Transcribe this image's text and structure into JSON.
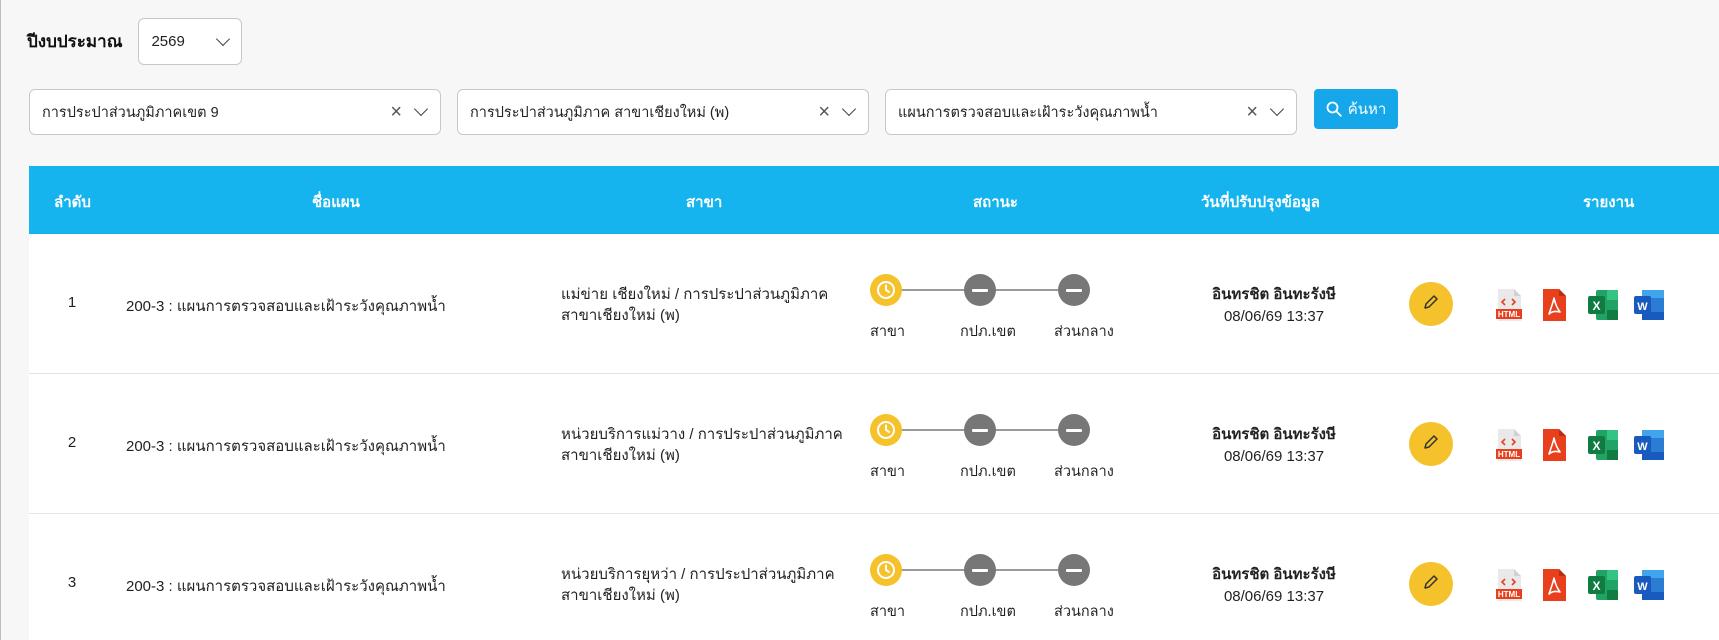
{
  "year": {
    "label": "ปีงบประมาณ",
    "value": "2569"
  },
  "filters": [
    {
      "value": "การประปาส่วนภูมิภาคเขต 9",
      "clear_icon": "×"
    },
    {
      "value": "การประปาส่วนภูมิภาค สาขาเชียงใหม่ (พ)",
      "clear_icon": "×"
    },
    {
      "value": "แผนการตรวจสอบและเฝ้าระวังคุณภาพน้ำ",
      "clear_icon": "×"
    }
  ],
  "search_button": {
    "label": "ค้นหา",
    "icon": "search-icon"
  },
  "table": {
    "headers": {
      "no": "ลำดับ",
      "plan": "ชื่อแผน",
      "branch": "สาขา",
      "status": "สถานะ",
      "updated": "วันที่ปรับปรุงข้อมูล",
      "report": "รายงาน"
    },
    "status_labels": [
      "สาขา",
      "กปภ.เขต",
      "ส่วนกลาง"
    ],
    "rows": [
      {
        "no": "1",
        "plan": "200-3 : แผนการตรวจสอบและเฝ้าระวังคุณภาพน้ำ",
        "branch_line1": "แม่ข่าย เชียงใหม่ / การประปาส่วนภูมิภาค",
        "branch_line2": "สาขาเชียงใหม่ (พ)",
        "updated_by": "อินทรชิต อินทะรังษี",
        "updated_at": "08/06/69 13:37"
      },
      {
        "no": "2",
        "plan": "200-3 : แผนการตรวจสอบและเฝ้าระวังคุณภาพน้ำ",
        "branch_line1": "หน่วยบริการแม่วาง / การประปาส่วนภูมิภาค",
        "branch_line2": "สาขาเชียงใหม่ (พ)",
        "updated_by": "อินทรชิต อินทะรังษี",
        "updated_at": "08/06/69 13:37"
      },
      {
        "no": "3",
        "plan": "200-3 : แผนการตรวจสอบและเฝ้าระวังคุณภาพน้ำ",
        "branch_line1": "หน่วยบริการยุหว่า / การประปาส่วนภูมิภาค",
        "branch_line2": "สาขาเชียงใหม่ (พ)",
        "updated_by": "อินทรชิต อินทะรังษี",
        "updated_at": "08/06/69 13:37"
      }
    ],
    "report_icons": [
      "html-file-icon",
      "pdf-file-icon",
      "excel-file-icon",
      "word-file-icon"
    ],
    "report_icon_texts": {
      "html": "HTML",
      "excel": "X",
      "word": "W"
    }
  },
  "colors": {
    "header_bg": "#15b4ee",
    "search_bg": "#15a7ea",
    "pending": "#f5c22b",
    "inactive": "#777777",
    "pdf": "#e8401c",
    "excel": "#1f8a4c",
    "word": "#1e5fb4"
  }
}
